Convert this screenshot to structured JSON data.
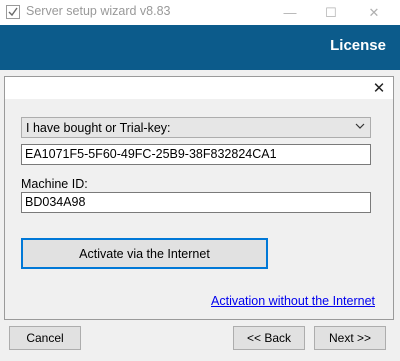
{
  "window": {
    "title": "Server setup wizard v8.83",
    "minimize_glyph": "—",
    "maximize_glyph": "☐",
    "close_glyph": "✕"
  },
  "header": {
    "title": "License"
  },
  "dialog": {
    "close_glyph": "✕",
    "license_type": {
      "selected": "I have bought or Trial-key:"
    },
    "license_key": {
      "value": "EA1071F5-5F60-49FC-25B9-38F832824CA1"
    },
    "machine_id": {
      "label": "Machine ID:",
      "value": "BD034A98"
    },
    "activate_button": "Activate via the Internet",
    "offline_link": "Activation without the Internet"
  },
  "footer": {
    "cancel": "Cancel",
    "back": "<< Back",
    "next": "Next >>"
  },
  "colors": {
    "header_band": "#0c5b8b",
    "link": "#0000ee",
    "focus_border": "#0078d7"
  }
}
